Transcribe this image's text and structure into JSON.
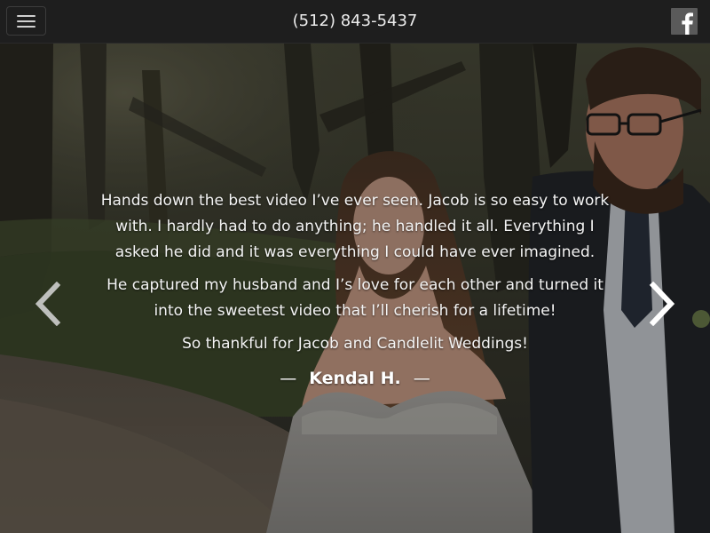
{
  "header": {
    "phone": "(512) 843-5437",
    "menu_icon": "hamburger-menu-icon",
    "social_icon": "facebook-icon"
  },
  "testimonial": {
    "paragraphs": [
      "Hands down the best video I’ve ever seen. Jacob is so easy to work with. I hardly had to do anything; he handled it all. Everything I asked he did and it was everything I could have ever imagined.",
      "He captured my husband and I’s love for each other and turned it into the sweetest video that I’ll cherish for a lifetime!",
      "So thankful for Jacob and Candlelit Weddings!"
    ],
    "author_dash": "—",
    "author": "Kendal H."
  },
  "carousel": {
    "prev_icon": "chevron-left-icon",
    "next_icon": "chevron-right-icon"
  },
  "colors": {
    "topbar": "#1e1e1e",
    "text": "#f4f4f4",
    "facebook_bg": "#5a5a5a"
  }
}
